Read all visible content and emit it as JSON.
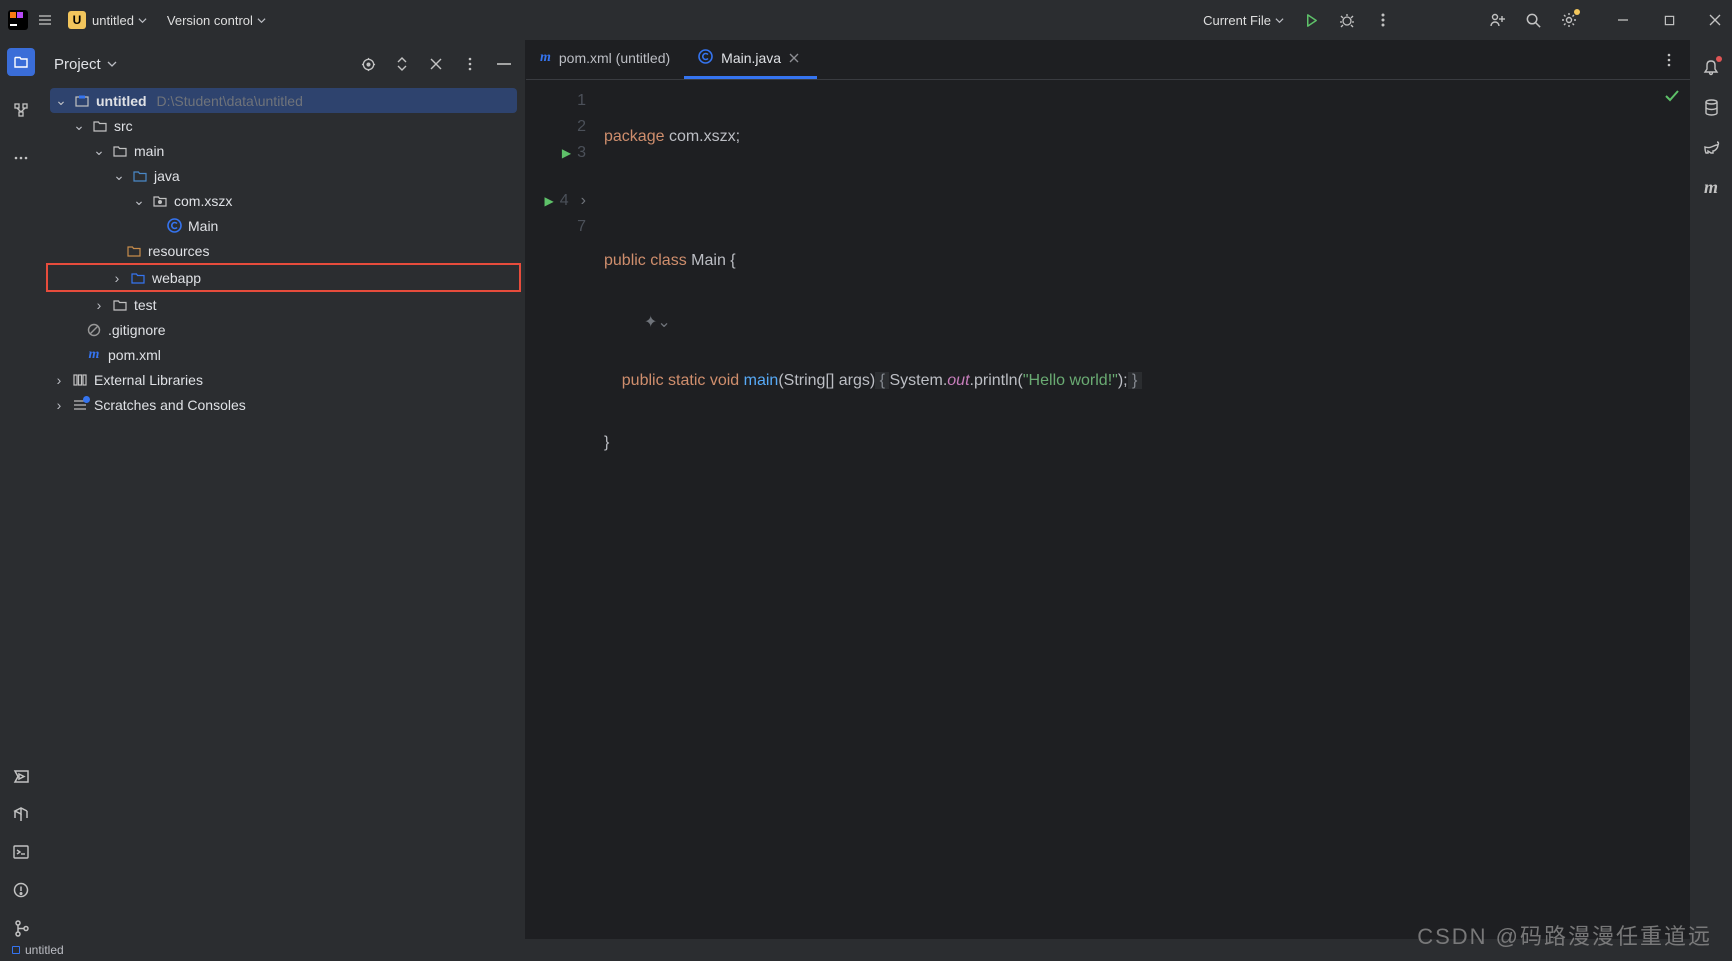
{
  "titlebar": {
    "project_badge": "U",
    "project_name": "untitled",
    "vcs": "Version control",
    "run_config": "Current File"
  },
  "panel": {
    "title": "Project"
  },
  "tree": {
    "root": {
      "name": "untitled",
      "path": "D:\\Student\\data\\untitled"
    },
    "src": "src",
    "main": "main",
    "java": "java",
    "pkg": "com.xszx",
    "cls": "Main",
    "resources": "resources",
    "webapp": "webapp",
    "test": "test",
    "gitignore": ".gitignore",
    "pom": "pom.xml",
    "ext": "External Libraries",
    "scratches": "Scratches and Consoles"
  },
  "tabs": {
    "t1": "pom.xml (untitled)",
    "t2": "Main.java"
  },
  "gutter": {
    "l1": "1",
    "l2": "2",
    "l3": "3",
    "l4": "4",
    "l7": "7"
  },
  "code": {
    "l1": {
      "kw": "package ",
      "txt": "com.xszx;"
    },
    "l3": {
      "kw1": "public ",
      "kw2": "class ",
      "cls": "Main {"
    },
    "l4": {
      "kw1": "public ",
      "kw2": "static ",
      "kw3": "void ",
      "fn": "main",
      "args": "(String[] args)",
      "open": " { ",
      "sys": "System.",
      "out": "out",
      "print": ".println(",
      "str": "\"Hello world!\"",
      "close": ");",
      "end": " } "
    },
    "l7": "}"
  },
  "status": {
    "project": "untitled"
  },
  "watermark": "CSDN @码路漫漫任重道远"
}
